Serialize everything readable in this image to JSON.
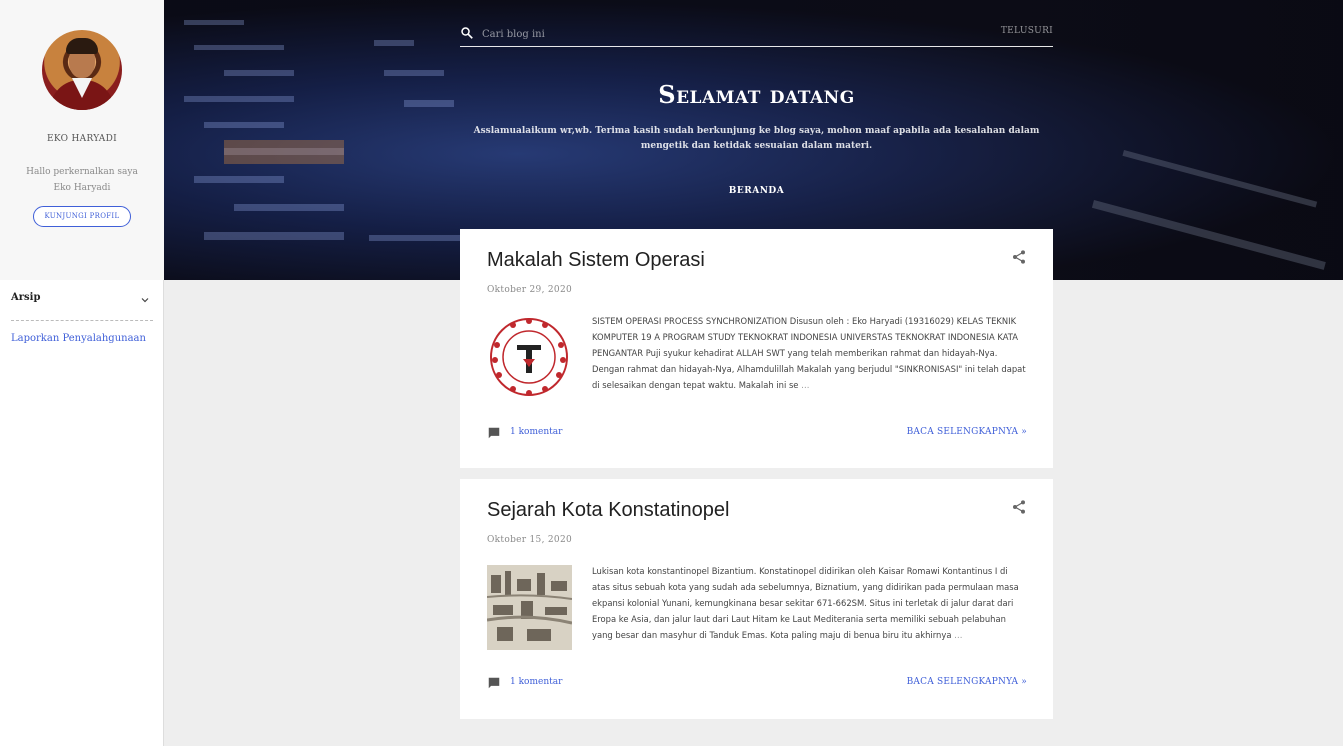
{
  "profile": {
    "name": "EKO HARYADI",
    "description": "Hallo perkernalkan saya Eko Haryadi",
    "visit_button": "KUNJUNGI PROFIL"
  },
  "sidebar": {
    "archive_title": "Arsip",
    "report_link": "Laporkan Penyalahgunaan"
  },
  "header": {
    "search_placeholder": "Cari blog ini",
    "search_button": "TELUSURI",
    "title": "Selamat datang",
    "description": "Asslamualaikum wr,wb. Terima kasih sudah berkunjung ke blog saya, mohon maaf apabila ada kesalahan dalam mengetik dan ketidak sesuaian dalam materi.",
    "nav_home": "BERANDA"
  },
  "posts": [
    {
      "title": "Makalah Sistem Operasi",
      "date": "Oktober 29, 2020",
      "snippet": "SISTEM OPERASI PROCESS SYNCHRONIZATION   Disusun oleh : Eko Haryadi (19316029) KELAS TEKNIK KOMPUTER 19 A PROGRAM STUDY TEKNOKRAT INDONESIA UNIVERSTAS TEKNOKRAT INDONESIA         KATA PENGANTAR Puji syukur kehadirat ALLAH SWT yang telah memberikan rahmat dan hidayah-Nya. Dengan rahmat dan hidayah-Nya, Alhamdulillah Makalah yang berjudul \"SINKRONISASI\" ini telah dapat di selesaikan dengan tepat waktu. Makalah ini se",
      "ellipsis": "…",
      "comments": "1 komentar",
      "read_more": "BACA SELENGKAPNYA »"
    },
    {
      "title": "Sejarah Kota Konstatinopel",
      "date": "Oktober 15, 2020",
      "snippet": "Lukisan  kota konstantinopel   Bizantium. Konstatinopel didirikan oleh Kaisar Romawi Kontantinus I di atas situs sebuah kota yang sudah ada sebelumnya, Biznatium, yang didirikan pada permulaan masa ekpansi kolonial Yunani, kemungkinana besar sekitar 671-662SM. Situs ini terletak di jalur darat dari Eropa ke Asia, dan jalur laut dari Laut Hitam ke Laut Mediterania serta memiliki sebuah pelabuhan yang besar dan masyhur di Tanduk Emas. Kota paling maju di benua biru itu akhirnya",
      "ellipsis": "…",
      "comments": "1 komentar",
      "read_more": "BACA SELENGKAPNYA »"
    }
  ],
  "colors": {
    "accent": "#3f5fd8",
    "background": "#eeeeee",
    "header_dark": "#1c2a55"
  }
}
